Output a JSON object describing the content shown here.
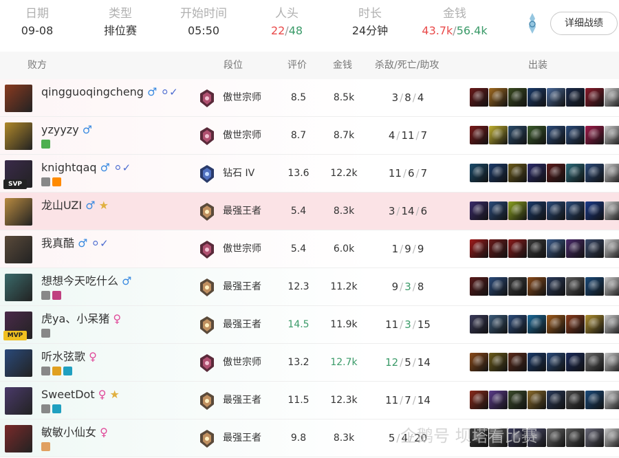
{
  "summary": {
    "date": {
      "label": "日期",
      "value": "09-08"
    },
    "type": {
      "label": "类型",
      "value": "排位赛"
    },
    "start": {
      "label": "开始时间",
      "value": "05:50"
    },
    "kills": {
      "label": "人头",
      "lose": "22",
      "sep": "/",
      "win": "48"
    },
    "duration": {
      "label": "时长",
      "value": "24分钟"
    },
    "gold": {
      "label": "金钱",
      "lose": "43.7k",
      "sep": "/",
      "win": "56.4k"
    },
    "detail_button": "详细战绩"
  },
  "header": {
    "team": "败方",
    "rank": "段位",
    "rating": "评价",
    "gold": "金钱",
    "kda": "杀敌/死亡/助攻",
    "items": "出装"
  },
  "colors": {
    "lose": "#e94a4a",
    "win": "#3a9a68",
    "highlight_row": "#fbe3e6"
  },
  "players": [
    {
      "name": "qingguoqingcheng",
      "gender": "♂",
      "verified": true,
      "rank": "傲世宗师",
      "rating": "8.5",
      "gold": "8.5k",
      "k": "3",
      "d": "8",
      "a": "4",
      "badge": "",
      "avatar": "#8a3a20",
      "items": [
        "#6a1a1a",
        "#a06a20",
        "#3a4a20",
        "#1a3a6a",
        "#4a6a9a",
        "#1a2a4a",
        "#8a1a2a",
        "#c8c8c8"
      ],
      "icons": []
    },
    {
      "name": "yzyyzy",
      "gender": "♂",
      "verified": false,
      "rank": "傲世宗师",
      "rating": "8.7",
      "gold": "8.7k",
      "k": "4",
      "d": "11",
      "a": "7",
      "badge": "",
      "avatar": "#b0882a",
      "items": [
        "#7a1a1a",
        "#c0b030",
        "#2a4a6a",
        "#3a5a2a",
        "#2a4a7a",
        "#2a4a7a",
        "#a01a4a",
        "#c8c8c8"
      ],
      "icons": [
        {
          "n": "shield-icon",
          "c": "#4caf50"
        }
      ]
    },
    {
      "name": "knightqaq",
      "gender": "♂",
      "verified": true,
      "rank": "钻石 IV",
      "rating": "13.6",
      "gold": "12.2k",
      "k": "11",
      "d": "6",
      "a": "7",
      "badge": "SVP",
      "avatar": "#3a2a4a",
      "items": [
        "#1a4a6a",
        "#1a3a6a",
        "#6a5a1a",
        "#2a2a6a",
        "#5a1a1a",
        "#2a6a7a",
        "#2a4a7a",
        "#c8c8c8"
      ],
      "icons": [
        {
          "n": "list-icon",
          "c": "#888"
        },
        {
          "n": "fire-icon",
          "c": "#ff8a00"
        }
      ]
    },
    {
      "name": "龙山UZI",
      "gender": "♂",
      "verified": false,
      "rank": "最强王者",
      "rating": "5.4",
      "gold": "8.3k",
      "k": "3",
      "d": "14",
      "a": "6",
      "badge": "",
      "avatar": "#b88a40",
      "items": [
        "#3a2a6a",
        "#2a4a7a",
        "#8aa020",
        "#1a3a6a",
        "#2a4a7a",
        "#2a4a7a",
        "#1a3a8a",
        "#c8c8c8"
      ],
      "icons": [],
      "highlight": true,
      "trophy": true
    },
    {
      "name": "我真酷",
      "gender": "♂",
      "verified": true,
      "rank": "傲世宗师",
      "rating": "5.4",
      "gold": "6.0k",
      "k": "1",
      "d": "9",
      "a": "9",
      "badge": "",
      "avatar": "#5a4a3a",
      "items": [
        "#a01a1a",
        "#6a1a1a",
        "#8a1a1a",
        "#3a3a3a",
        "#3a5a8a",
        "#4a2a6a",
        "#3a4a6a",
        "#c8c8c8"
      ],
      "icons": []
    },
    {
      "name": "想想今天吃什么",
      "gender": "♂",
      "verified": false,
      "rank": "最强王者",
      "rating": "12.3",
      "gold": "11.2k",
      "k": "9",
      "d": "3",
      "a": "8",
      "badge": "",
      "avatar": "#3a6a6a",
      "items": [
        "#5a1a1a",
        "#2a4a7a",
        "#3a3a3a",
        "#8a4a1a",
        "#2a3a5a",
        "#5a5a5a",
        "#1a4a7a",
        "#c8c8c8"
      ],
      "icons": [
        {
          "n": "list-icon",
          "c": "#888"
        },
        {
          "n": "alien-icon",
          "c": "#c04080"
        }
      ],
      "win": true
    },
    {
      "name": "虎ya、小呆猪",
      "gender": "♀",
      "verified": false,
      "rank": "最强王者",
      "rating": "14.5",
      "gold": "11.9k",
      "k": "11",
      "d": "3",
      "a": "15",
      "badge": "MVP",
      "avatar": "#4a2a4a",
      "items": [
        "#3a3a5a",
        "#3a5a7a",
        "#2a4a7a",
        "#1a6a9a",
        "#a05a1a",
        "#8a3a1a",
        "#b09030",
        "#c8c8c8"
      ],
      "icons": [
        {
          "n": "list-icon",
          "c": "#888"
        }
      ],
      "win": true,
      "rating_green": true
    },
    {
      "name": "听水弦歌",
      "gender": "♀",
      "verified": false,
      "rank": "傲世宗师",
      "rating": "13.2",
      "gold": "12.7k",
      "k": "12",
      "d": "5",
      "a": "14",
      "badge": "",
      "avatar": "#2a4a7a",
      "items": [
        "#8a4a1a",
        "#6a5a1a",
        "#5a2a1a",
        "#1a3a6a",
        "#2a4a7a",
        "#1a2a5a",
        "#6a6a6a",
        "#c8c8c8"
      ],
      "icons": [
        {
          "n": "sword-icon",
          "c": "#888"
        },
        {
          "n": "gold-icon",
          "c": "#e0a020"
        },
        {
          "n": "fish-icon",
          "c": "#20a0c0"
        }
      ],
      "win": true,
      "gold_green": true,
      "k_green": true
    },
    {
      "name": "SweetDot",
      "gender": "♀",
      "verified": false,
      "rank": "最强王者",
      "rating": "11.5",
      "gold": "12.3k",
      "k": "11",
      "d": "7",
      "a": "14",
      "badge": "",
      "avatar": "#4a3a6a",
      "items": [
        "#8a2a1a",
        "#5a3a8a",
        "#3a4a2a",
        "#8a6a2a",
        "#2a3a5a",
        "#4a4a4a",
        "#1a4a7a",
        "#c8c8c8"
      ],
      "icons": [
        {
          "n": "list-icon",
          "c": "#888"
        },
        {
          "n": "fish-icon",
          "c": "#20a0c0"
        }
      ],
      "win": true,
      "trophy": true
    },
    {
      "name": "敏敏小仙女",
      "gender": "♀",
      "verified": false,
      "rank": "最强王者",
      "rating": "9.8",
      "gold": "8.3k",
      "k": "5",
      "d": "4",
      "a": "20",
      "badge": "",
      "avatar": "#7a2a2a",
      "items": [
        "#3a3a3a",
        "#5a5a5a",
        "#3a3a5a",
        "#4a4a6a",
        "#6a6a6a",
        "#5a5a5a",
        "#6a6a7a",
        "#c8c8c8"
      ],
      "icons": [
        {
          "n": "box-icon",
          "c": "#e0a060"
        }
      ],
      "win": true
    }
  ],
  "watermark": "企鹅号 坝塔看比赛"
}
